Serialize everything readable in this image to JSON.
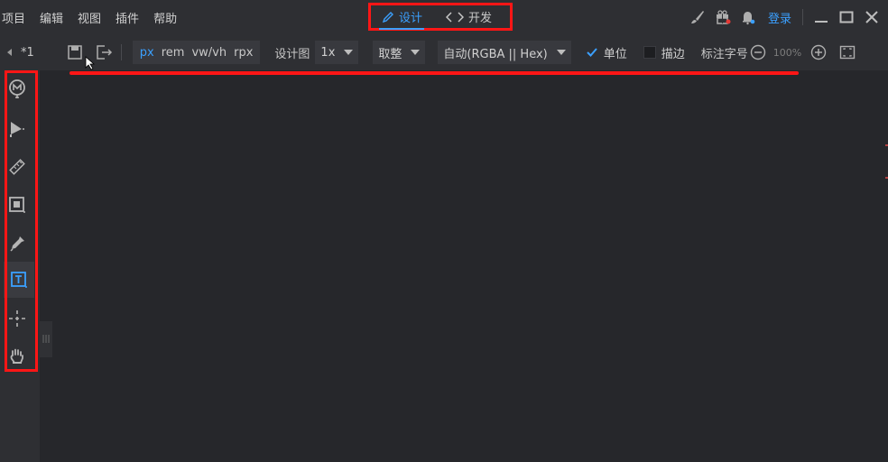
{
  "menu": [
    "项目",
    "编辑",
    "视图",
    "插件",
    "帮助"
  ],
  "modes": {
    "design": "设计",
    "develop": "开发"
  },
  "header": {
    "login": "登录"
  },
  "doc": {
    "name": "*1"
  },
  "units": [
    "px",
    "rem",
    "vw/vh",
    "rpx"
  ],
  "active_unit": "px",
  "design_scale": {
    "label": "设计图",
    "value": "1x"
  },
  "rounding": {
    "value": "取整"
  },
  "color_format": {
    "value": "自动(RGBA || Hex)"
  },
  "unit_toggle": {
    "label": "单位",
    "checked": true
  },
  "stroke_toggle": {
    "label": "描边",
    "checked": false
  },
  "annotation_font": {
    "label": "标注字号"
  },
  "zoom": {
    "value": "100%"
  },
  "colors": {
    "accent": "#3ba0ff",
    "highlight_box": "#ff1616",
    "background": "#26272b"
  },
  "sidebar_tools": [
    "marker-tool-icon",
    "play-flag-icon",
    "ruler-icon",
    "frame-icon",
    "eyedropper-icon",
    "text-tool-icon",
    "crosshair-icon",
    "hand-icon"
  ],
  "active_tool": "text-tool-icon"
}
